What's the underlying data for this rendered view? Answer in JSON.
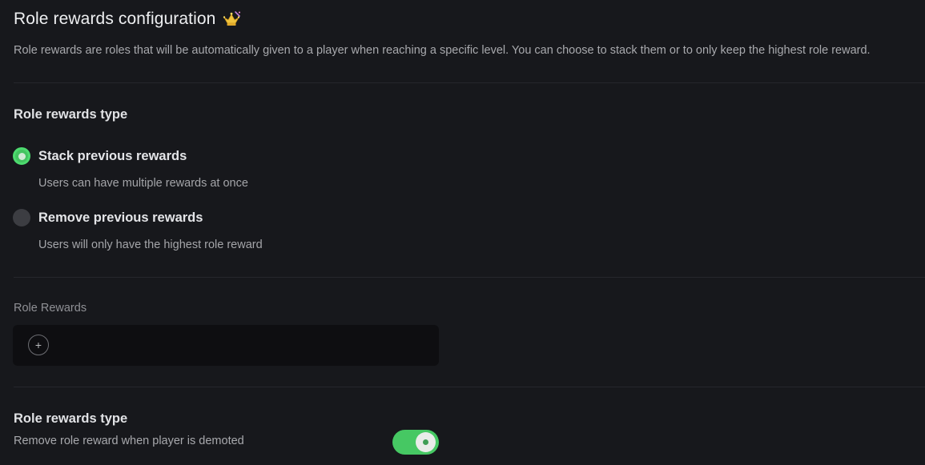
{
  "header": {
    "title": "Role rewards configuration",
    "title_icon": "crown-icon",
    "description": "Role rewards are roles that will be automatically given to a player when reaching a specific level. You can choose to stack them or to only keep the highest role reward."
  },
  "rewards_type": {
    "heading": "Role rewards type",
    "options": [
      {
        "label": "Stack previous rewards",
        "sublabel": "Users can have multiple rewards at once",
        "selected": true
      },
      {
        "label": "Remove previous rewards",
        "sublabel": "Users will only have the highest role reward",
        "selected": false
      }
    ]
  },
  "role_rewards": {
    "label": "Role Rewards",
    "add_symbol": "+"
  },
  "demotion": {
    "heading": "Role rewards type",
    "label": "Remove role reward when player is demoted",
    "enabled": true
  },
  "colors": {
    "background": "#17181c",
    "accent_green": "#46c863",
    "field_background": "#0e0e11"
  }
}
